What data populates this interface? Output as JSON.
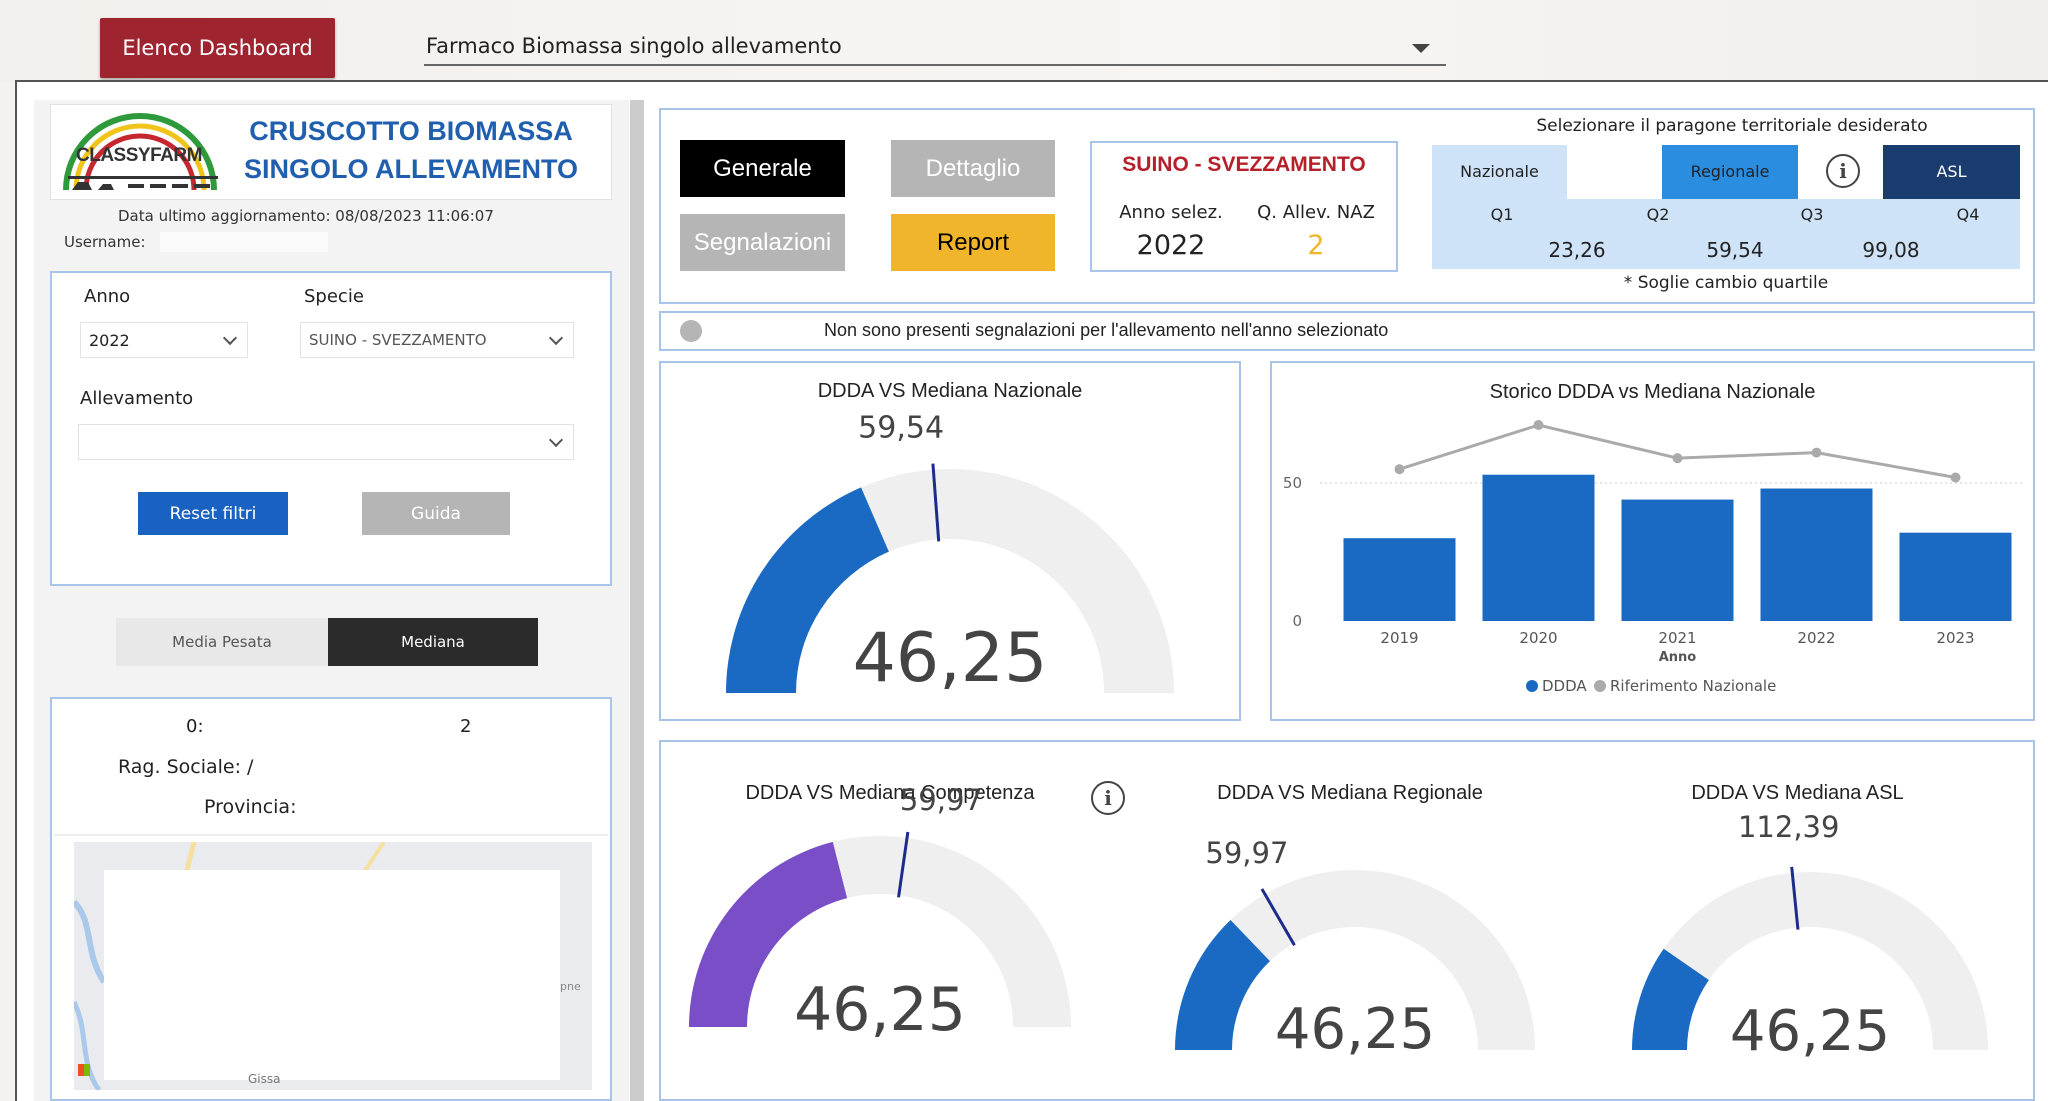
{
  "topbar": {
    "elenco_label": "Elenco Dashboard",
    "dashboard_selected": "Farmaco Biomassa singolo allevamento"
  },
  "sidebar": {
    "logo_text": "CLASSYFARM",
    "title_line1": "CRUSCOTTO BIOMASSA",
    "title_line2": "SINGOLO ALLEVAMENTO",
    "last_update": "Data ultimo aggiornamento: 08/08/2023 11:06:07",
    "username_label": "Username:",
    "filters": {
      "anno_label": "Anno",
      "anno_value": "2022",
      "specie_label": "Specie",
      "specie_value": "SUINO - SVEZZAMENTO",
      "allevamento_label": "Allevamento",
      "allevamento_value": "",
      "reset_label": "Reset filtri",
      "guida_label": "Guida"
    },
    "toggle": {
      "media_pesata": "Media Pesata",
      "mediana": "Mediana"
    },
    "farm_info": {
      "code_left": "0:",
      "code_right": "2",
      "rag_sociale": "Rag. Sociale: /",
      "provincia": "Provincia:",
      "map_text_right": "pne",
      "map_text_bottom": "Gissa"
    }
  },
  "nav": {
    "generale": "Generale",
    "dettaglio": "Dettaglio",
    "segnalazioni": "Segnalazioni",
    "report": "Report"
  },
  "species_card": {
    "title": "SUINO - SVEZZAMENTO",
    "anno_label": "Anno selez.",
    "anno_value": "2022",
    "qallev_label": "Q. Allev. NAZ",
    "qallev_value": "2"
  },
  "territorial": {
    "caption": "Selezionare il paragone territoriale desiderato",
    "nazionale": "Nazionale",
    "regionale": "Regionale",
    "asl": "ASL",
    "q1": "Q1",
    "q2": "Q2",
    "q3": "Q3",
    "q4": "Q4",
    "t1": "23,26",
    "t2": "59,54",
    "t3": "99,08",
    "footnote": "* Soglie cambio quartile"
  },
  "alert": {
    "message": "Non sono presenti segnalazioni per l'allevamento nell'anno selezionato"
  },
  "colors": {
    "blue": "#1a6ac4",
    "purple": "#7a4ec6",
    "grey_track": "#efefef",
    "gold": "#f1b52c",
    "dark_blue": "#1b3c6e"
  },
  "chart_data": [
    {
      "type": "gauge",
      "id": "naz",
      "title": "DDDA VS Mediana Nazionale",
      "value": 46.25,
      "value_label": "46,25",
      "target": 59.54,
      "target_label": "59,54",
      "max": 125
    },
    {
      "type": "bar",
      "title": "Storico DDDA vs Mediana Nazionale",
      "xlabel": "Anno",
      "categories": [
        "2019",
        "2020",
        "2021",
        "2022",
        "2023"
      ],
      "yticks": [
        0,
        50
      ],
      "ylim": [
        0,
        75
      ],
      "series": [
        {
          "name": "DDDA",
          "type": "bar",
          "values": [
            30,
            53,
            44,
            48,
            32
          ]
        },
        {
          "name": "Riferimento Nazionale",
          "type": "line",
          "values": [
            55,
            71,
            59,
            61,
            52
          ]
        }
      ],
      "legend": "bottom"
    },
    {
      "type": "gauge",
      "id": "comp",
      "title": "DDDA VS Mediana Competenza",
      "value": 46.25,
      "value_label": "46,25",
      "target": 59.97,
      "target_label": "59,97",
      "max": 110
    },
    {
      "type": "gauge",
      "id": "reg",
      "title": "DDDA VS Mediana Regionale",
      "value": 46.25,
      "value_label": "46,25",
      "target": 59.97,
      "target_label": "59,97",
      "max": 180
    },
    {
      "type": "gauge",
      "id": "asl",
      "title": "DDDA VS Mediana ASL",
      "value": 46.25,
      "value_label": "46,25",
      "target": 112.39,
      "target_label": "112,39",
      "max": 240
    }
  ]
}
